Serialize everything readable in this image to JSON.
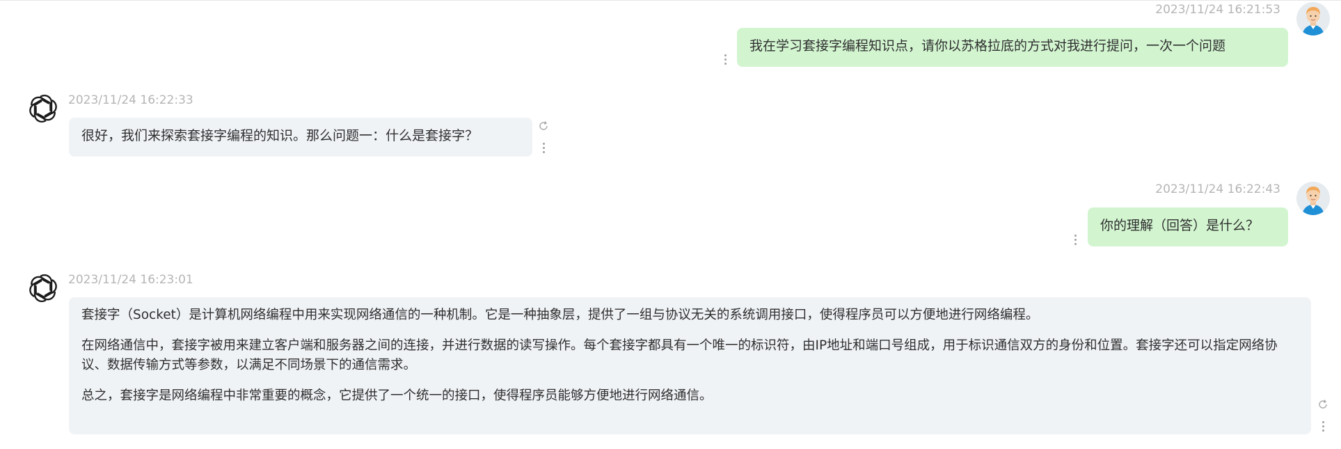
{
  "messages": [
    {
      "role": "user",
      "timestamp": "2023/11/24 16:21:53",
      "text": "我在学习套接字编程知识点，请你以苏格拉底的方式对我进行提问，一次一个问题"
    },
    {
      "role": "assistant",
      "timestamp": "2023/11/24 16:22:33",
      "paragraphs": [
        "很好，我们来探索套接字编程的知识。那么问题一：什么是套接字？"
      ]
    },
    {
      "role": "user",
      "timestamp": "2023/11/24 16:22:43",
      "text": "你的理解（回答）是什么？"
    },
    {
      "role": "assistant",
      "timestamp": "2023/11/24 16:23:01",
      "paragraphs": [
        "套接字（Socket）是计算机网络编程中用来实现网络通信的一种机制。它是一种抽象层，提供了一组与协议无关的系统调用接口，使得程序员可以方便地进行网络编程。",
        "在网络通信中，套接字被用来建立客户端和服务器之间的连接，并进行数据的读写操作。每个套接字都具有一个唯一的标识符，由IP地址和端口号组成，用于标识通信双方的身份和位置。套接字还可以指定网络协议、数据传输方式等参数，以满足不同场景下的通信需求。",
        "总之，套接字是网络编程中非常重要的概念，它提供了一个统一的接口，使得程序员能够方便地进行网络通信。"
      ]
    }
  ],
  "colors": {
    "user_bubble": "#d2f5d0",
    "assistant_bubble": "#f0f3f6",
    "timestamp": "#b5b5b5",
    "text": "#2e2e2e"
  },
  "icons": {
    "user_avatar": "user-avatar-icon",
    "assistant_avatar": "openai-logo-icon",
    "more": "more-vertical-icon",
    "regenerate": "regenerate-icon"
  }
}
